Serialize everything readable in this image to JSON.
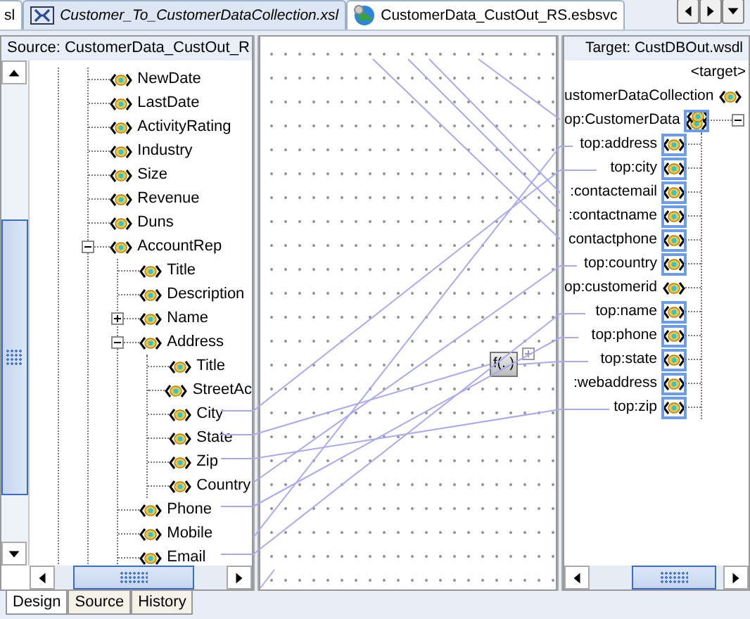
{
  "editor_tabs": [
    {
      "label": "sl",
      "selected": false,
      "kind": "plain"
    },
    {
      "label": "Customer_To_CustomerDataCollection.xsl",
      "selected": true,
      "kind": "xsl"
    },
    {
      "label": "CustomerData_CustOut_RS.esbsvc",
      "selected": false,
      "kind": "service"
    }
  ],
  "source_panel": {
    "title": "Source: CustomerData_CustOut_R",
    "tree": [
      {
        "label": "NewDate"
      },
      {
        "label": "LastDate"
      },
      {
        "label": "ActivityRating"
      },
      {
        "label": "Industry"
      },
      {
        "label": "Size"
      },
      {
        "label": "Revenue"
      },
      {
        "label": "Duns"
      },
      {
        "label": "AccountRep",
        "expanded": true,
        "children": [
          {
            "label": "Title"
          },
          {
            "label": "Description"
          },
          {
            "label": "Name",
            "expanded": false
          },
          {
            "label": "Address",
            "expanded": true,
            "children": [
              {
                "label": "Title"
              },
              {
                "label": "StreetAc"
              },
              {
                "label": "City"
              },
              {
                "label": "State"
              },
              {
                "label": "Zip"
              },
              {
                "label": "Country"
              }
            ]
          },
          {
            "label": "Phone"
          },
          {
            "label": "Mobile"
          },
          {
            "label": "Email"
          }
        ]
      }
    ]
  },
  "mapping_canvas": {
    "function_node": "f(..)"
  },
  "target_panel": {
    "title": "Target: CustDBOut.wsdl",
    "root": "<target>",
    "tree": [
      {
        "label": "ustomerDataCollection",
        "kind": "element",
        "mapped": false,
        "children": [
          {
            "label": "op:CustomerData",
            "kind": "repeating",
            "mapped": true,
            "expanded": true,
            "children": [
              {
                "label": "top:address",
                "kind": "element",
                "mapped": true
              },
              {
                "label": "top:city",
                "kind": "element",
                "mapped": true
              },
              {
                "label": ":contactemail",
                "kind": "element",
                "mapped": true
              },
              {
                "label": ":contactname",
                "kind": "element",
                "mapped": true
              },
              {
                "label": "contactphone",
                "kind": "element",
                "mapped": true
              },
              {
                "label": "top:country",
                "kind": "element",
                "mapped": true
              },
              {
                "label": "op:customerid",
                "kind": "element",
                "mapped": false
              },
              {
                "label": "top:name",
                "kind": "element",
                "mapped": true
              },
              {
                "label": "top:phone",
                "kind": "element",
                "mapped": true
              },
              {
                "label": "top:state",
                "kind": "element",
                "mapped": true
              },
              {
                "label": ":webaddress",
                "kind": "element",
                "mapped": true
              },
              {
                "label": "top:zip",
                "kind": "element",
                "mapped": true
              }
            ]
          }
        ]
      }
    ]
  },
  "bottom_tabs": [
    {
      "label": "Design",
      "selected": true
    },
    {
      "label": "Source",
      "selected": false
    },
    {
      "label": "History",
      "selected": false
    }
  ]
}
